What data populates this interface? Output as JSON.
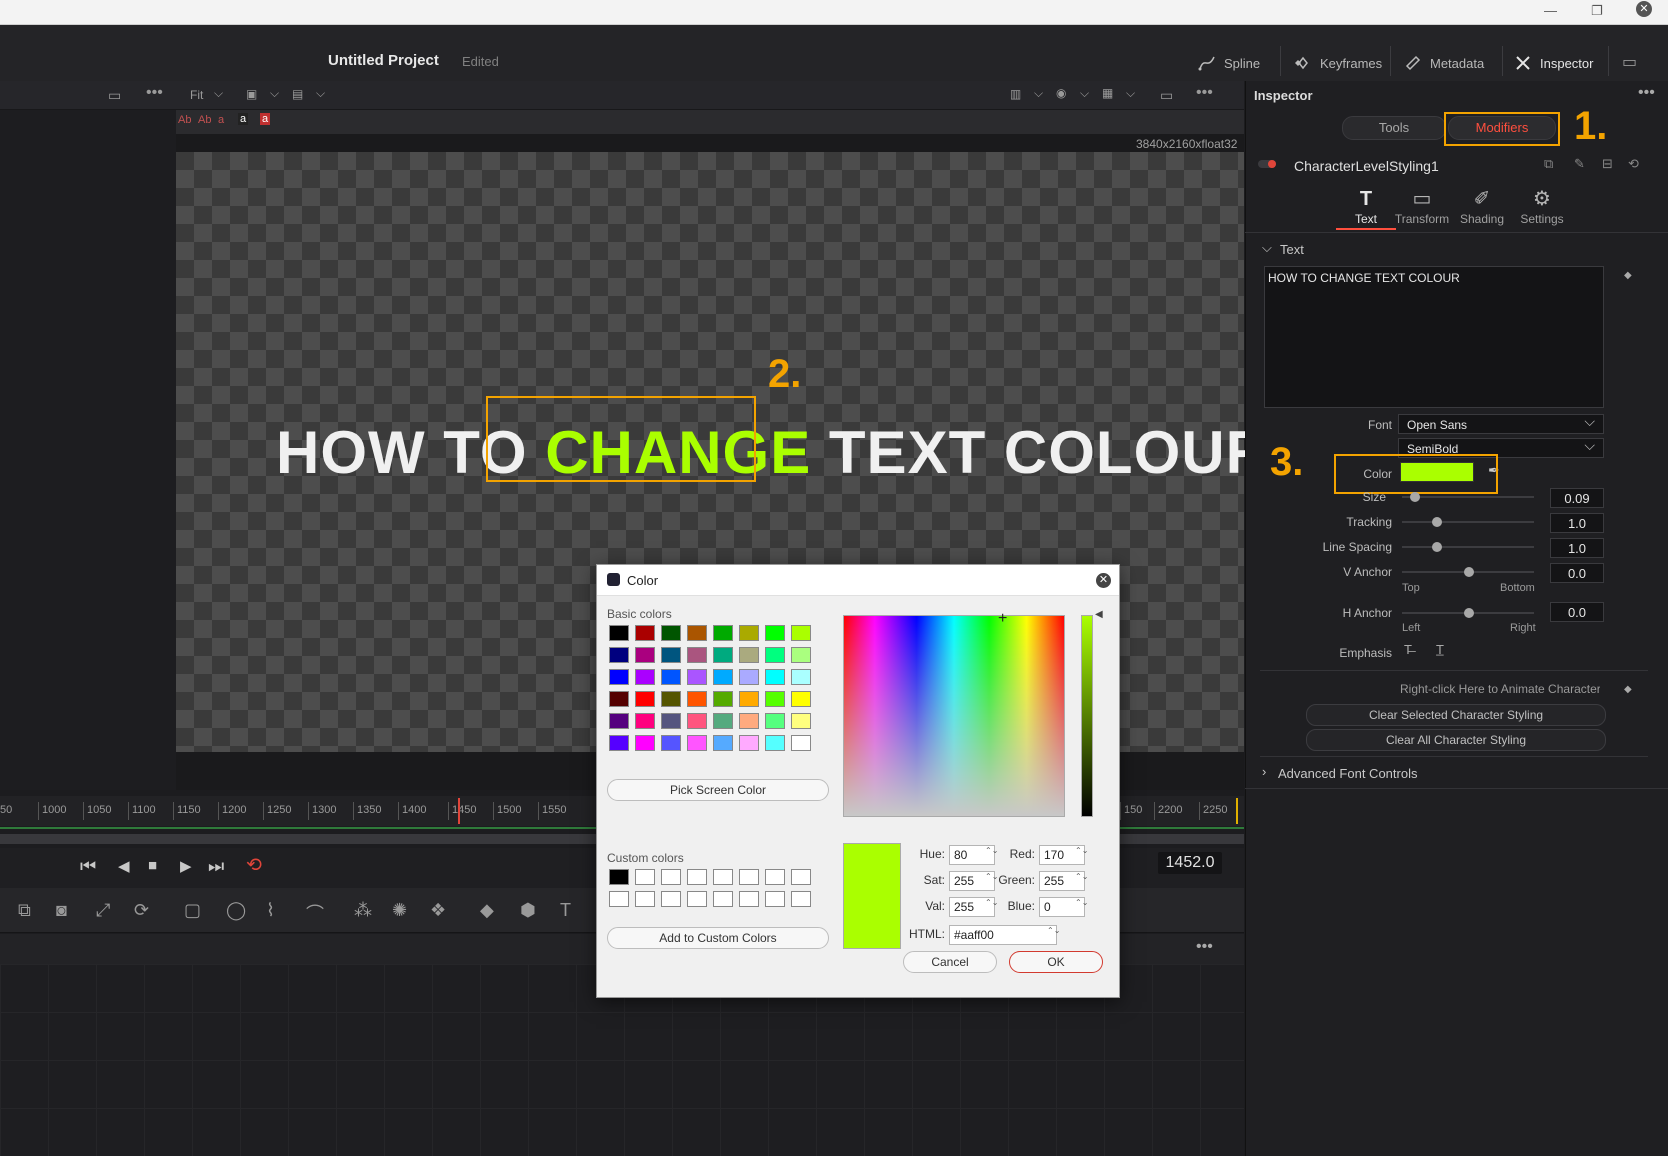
{
  "project": {
    "title": "Untitled Project",
    "status": "Edited"
  },
  "header_tabs": [
    {
      "label": "Spline",
      "icon": "spline-icon"
    },
    {
      "label": "Keyframes",
      "icon": "keyframes-icon"
    },
    {
      "label": "Metadata",
      "icon": "metadata-icon"
    },
    {
      "label": "Inspector",
      "icon": "inspector-icon"
    }
  ],
  "viewer": {
    "zoom": "Fit",
    "resolution": "3840x2160xfloat32",
    "text_tools": [
      "Ab",
      "Ab",
      "a",
      "a",
      "a"
    ],
    "canvas_text": {
      "before": "HOW TO ",
      "highlight": "CHANGE",
      "after": " TEXT COLOUR"
    },
    "highlight_color": "#aaff00"
  },
  "annotations": {
    "step1": "1.",
    "step2": "2.",
    "step3": "3."
  },
  "timeline": {
    "ticks": [
      "50",
      "1000",
      "1050",
      "1100",
      "1150",
      "1200",
      "1250",
      "1300",
      "1350",
      "1400",
      "1450",
      "1500",
      "1550",
      "150",
      "2200",
      "2250"
    ],
    "current_frame": "1452.0"
  },
  "inspector": {
    "title": "Inspector",
    "segments": {
      "tools": "Tools",
      "modifiers": "Modifiers"
    },
    "node_name": "CharacterLevelStyling1",
    "tabs": [
      "Text",
      "Transform",
      "Shading",
      "Settings"
    ],
    "section_text": "Text",
    "text_value": "HOW TO CHANGE TEXT COLOUR",
    "font_label": "Font",
    "font": "Open Sans",
    "style": "SemiBold",
    "color_label": "Color",
    "color_value": "#aaff00",
    "size_label": "Size",
    "size": "0.09",
    "tracking_label": "Tracking",
    "tracking": "1.0",
    "line_spacing_label": "Line Spacing",
    "line_spacing": "1.0",
    "v_anchor_label": "V Anchor",
    "v_anchor": "0.0",
    "v_anchor_min": "Top",
    "v_anchor_max": "Bottom",
    "h_anchor_label": "H Anchor",
    "h_anchor": "0.0",
    "h_anchor_min": "Left",
    "h_anchor_max": "Right",
    "emphasis_label": "Emphasis",
    "animate_hint": "Right-click Here to Animate Character Le",
    "clear_selected": "Clear Selected Character Styling",
    "clear_all": "Clear All Character Styling",
    "advanced": "Advanced Font Controls"
  },
  "color_dialog": {
    "title": "Color",
    "basic_colors_label": "Basic colors",
    "basic_colors": [
      [
        "#000000",
        "#aa0000",
        "#005500",
        "#aa5500",
        "#00aa00",
        "#aaaa00",
        "#00ff00",
        "#aaff00"
      ],
      [
        "#00007f",
        "#aa007f",
        "#00557f",
        "#aa557f",
        "#00aa7f",
        "#aaaa7f",
        "#00ff7f",
        "#aaff7f"
      ],
      [
        "#0000ff",
        "#aa00ff",
        "#0055ff",
        "#aa55ff",
        "#00aaff",
        "#aaaaff",
        "#00ffff",
        "#aaffff"
      ],
      [
        "#550000",
        "#ff0000",
        "#555500",
        "#ff5500",
        "#55aa00",
        "#ffaa00",
        "#55ff00",
        "#ffff00"
      ],
      [
        "#55007f",
        "#ff007f",
        "#55557f",
        "#ff557f",
        "#55aa7f",
        "#ffaa7f",
        "#55ff7f",
        "#ffff7f"
      ],
      [
        "#5500ff",
        "#ff00ff",
        "#5555ff",
        "#ff55ff",
        "#55aaff",
        "#ffaaff",
        "#55ffff",
        "#ffffff"
      ]
    ],
    "pick_screen": "Pick Screen Color",
    "custom_colors_label": "Custom colors",
    "custom_colors": [
      [
        "#000000",
        "#ffffff",
        "#ffffff",
        "#ffffff",
        "#ffffff",
        "#ffffff",
        "#ffffff",
        "#ffffff"
      ],
      [
        "#ffffff",
        "#ffffff",
        "#ffffff",
        "#ffffff",
        "#ffffff",
        "#ffffff",
        "#ffffff",
        "#ffffff"
      ]
    ],
    "add_custom": "Add to Custom Colors",
    "hue_label": "Hue:",
    "hue": "80",
    "sat_label": "Sat:",
    "sat": "255",
    "val_label": "Val:",
    "val": "255",
    "red_label": "Red:",
    "red": "170",
    "green_label": "Green:",
    "green": "255",
    "blue_label": "Blue:",
    "blue": "0",
    "html_label": "HTML:",
    "html": "#aaff00",
    "cancel": "Cancel",
    "ok": "OK"
  }
}
